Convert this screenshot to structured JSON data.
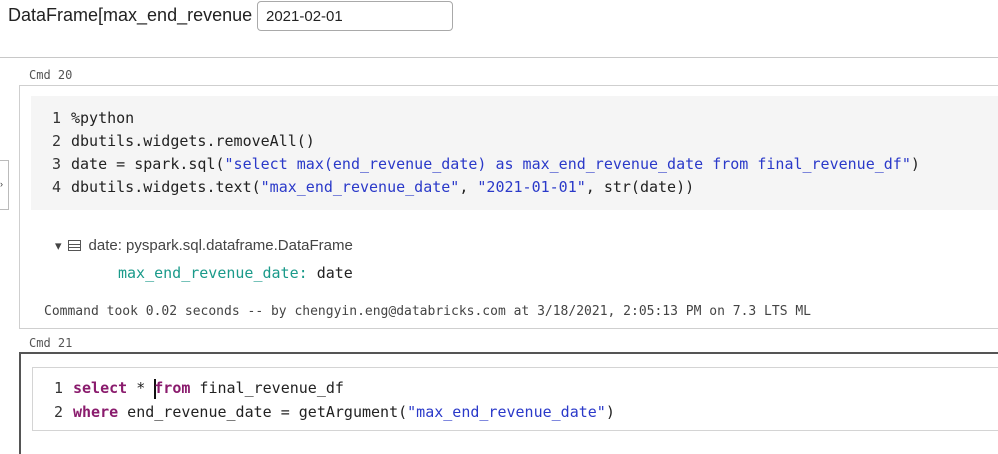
{
  "widget": {
    "label": "DataFrame[max_end_revenue",
    "value": "2021-02-01"
  },
  "cell20": {
    "cmd": "Cmd 20",
    "lines": [
      {
        "n": "1",
        "parts": [
          {
            "t": "%python",
            "c": "plain"
          }
        ]
      },
      {
        "n": "2",
        "parts": [
          {
            "t": "dbutils.widgets.removeAll()",
            "c": "plain"
          }
        ]
      },
      {
        "n": "3",
        "parts": [
          {
            "t": "date = spark.sql(",
            "c": "plain"
          },
          {
            "t": "\"select max(end_revenue_date) as max_end_revenue_date from final_revenue_df\"",
            "c": "str"
          },
          {
            "t": ")",
            "c": "plain"
          }
        ]
      },
      {
        "n": "4",
        "parts": [
          {
            "t": "dbutils.widgets.text(",
            "c": "plain"
          },
          {
            "t": "\"max_end_revenue_date\"",
            "c": "str"
          },
          {
            "t": ", ",
            "c": "plain"
          },
          {
            "t": "\"2021-01-01\"",
            "c": "str"
          },
          {
            "t": ", str(date))",
            "c": "plain"
          }
        ]
      }
    ],
    "output": {
      "toggle": "▾",
      "result": "date:  pyspark.sql.dataframe.DataFrame",
      "schema_field": "max_end_revenue_date:",
      "schema_type": "date"
    },
    "command_took": "Command took 0.02 seconds -- by chengyin.eng@databricks.com at 3/18/2021, 2:05:13 PM on 7.3 LTS ML"
  },
  "cell21": {
    "cmd": "Cmd 21",
    "lines": [
      {
        "n": "1",
        "parts": [
          {
            "t": "select",
            "c": "kw"
          },
          {
            "t": " * ",
            "c": "plain"
          },
          {
            "t": "CURSOR",
            "c": "cursor"
          },
          {
            "t": "from",
            "c": "kw"
          },
          {
            "t": " final_revenue_df",
            "c": "plain"
          }
        ]
      },
      {
        "n": "2",
        "parts": [
          {
            "t": "where",
            "c": "kw"
          },
          {
            "t": " end_revenue_date = getArgument(",
            "c": "plain"
          },
          {
            "t": "\"max_end_revenue_date\"",
            "c": "str"
          },
          {
            "t": ")",
            "c": "plain"
          }
        ]
      }
    ]
  },
  "side_toggle": "›",
  "icons": {
    "toggle": "triangle-down-icon",
    "result": "table-icon",
    "side": "chevron-right-icon"
  }
}
